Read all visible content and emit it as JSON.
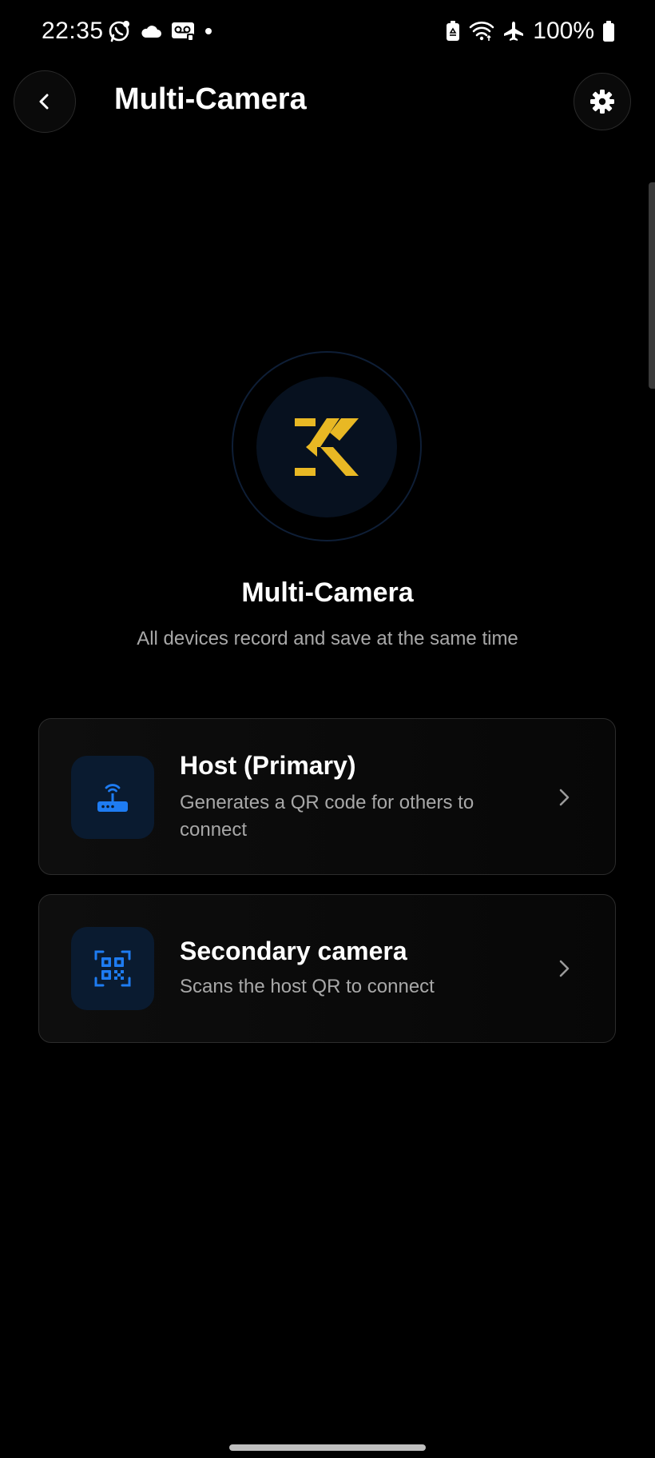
{
  "status_bar": {
    "time": "22:35",
    "left_icons": [
      "whatsapp-icon",
      "cloud-icon",
      "voicemail-icon",
      "dot-icon"
    ],
    "right_icons": [
      "battery-saver-icon",
      "wifi-icon",
      "airplane-icon",
      "battery-icon"
    ],
    "battery_text": "100%"
  },
  "header": {
    "title": "Multi-Camera",
    "back_icon": "chevron-left-icon",
    "settings_icon": "gear-icon"
  },
  "hero": {
    "logo": "brand-k-logo",
    "title": "Multi-Camera",
    "subtitle": "All devices record and save at the same time"
  },
  "options": [
    {
      "title": "Host (Primary)",
      "description": "Generates a QR code for others to connect",
      "icon": "router-icon"
    },
    {
      "title": "Secondary camera",
      "description": "Scans the host QR to connect",
      "icon": "qr-scan-icon"
    }
  ],
  "colors": {
    "background": "#000000",
    "accent_blue": "#1e7cf2",
    "logo_gold": "#e8b824",
    "secondary_text": "#a8a8a8"
  }
}
